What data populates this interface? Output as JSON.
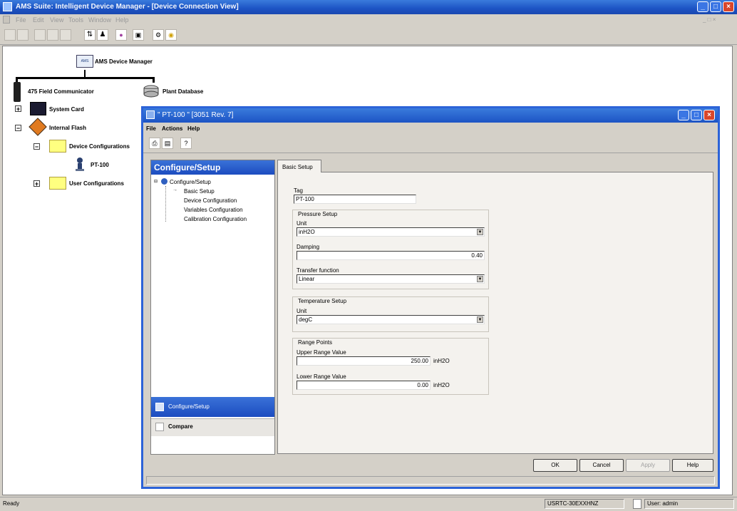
{
  "app": {
    "title": "AMS Suite: Intelligent Device Manager - [Device Connection View]",
    "menu": [
      "File",
      "Edit",
      "View",
      "Tools",
      "Window",
      "Help"
    ]
  },
  "tree": {
    "root": "AMS Device Manager",
    "communicator": "475 Field Communicator",
    "plant_db": "Plant Database",
    "system_card": "System Card",
    "internal_flash": "Internal Flash",
    "device_configs": "Device Configurations",
    "device": "PT-100",
    "user_configs": "User Configurations"
  },
  "child": {
    "title": "\" PT-100 \" [3051 Rev. 7]",
    "menu": [
      "File",
      "Actions",
      "Help"
    ],
    "panel_title": "Configure/Setup",
    "nav_tree": {
      "root": "Configure/Setup",
      "items": [
        "Basic Setup",
        "Device Configuration",
        "Variables Configuration",
        "Calibration Configuration"
      ]
    },
    "nav_buttons": {
      "configure": "Configure/Setup",
      "compare": "Compare"
    },
    "tab": "Basic Setup",
    "form": {
      "tag_label": "Tag",
      "tag_value": "PT-100",
      "pressure_group": "Pressure Setup",
      "pressure_unit_label": "Unit",
      "pressure_unit_value": "inH2O",
      "damping_label": "Damping",
      "damping_value": "0.40",
      "transfer_label": "Transfer function",
      "transfer_value": "Linear",
      "temp_group": "Temperature Setup",
      "temp_unit_label": "Unit",
      "temp_unit_value": "degC",
      "range_group": "Range Points",
      "urv_label": "Upper Range Value",
      "urv_value": "250.00",
      "urv_unit": "inH2O",
      "lrv_label": "Lower Range Value",
      "lrv_value": "0.00",
      "lrv_unit": "inH2O"
    },
    "buttons": {
      "ok": "OK",
      "cancel": "Cancel",
      "apply": "Apply",
      "help": "Help"
    }
  },
  "status": {
    "left": "Ready",
    "computer": "USRTC-30EXXHNZ",
    "user": "User: admin"
  },
  "colors": {
    "titlebar": "#1c53c4",
    "panel_header": "#1c4cc0",
    "close_button": "#d9462b",
    "folder": "#ffff80"
  }
}
